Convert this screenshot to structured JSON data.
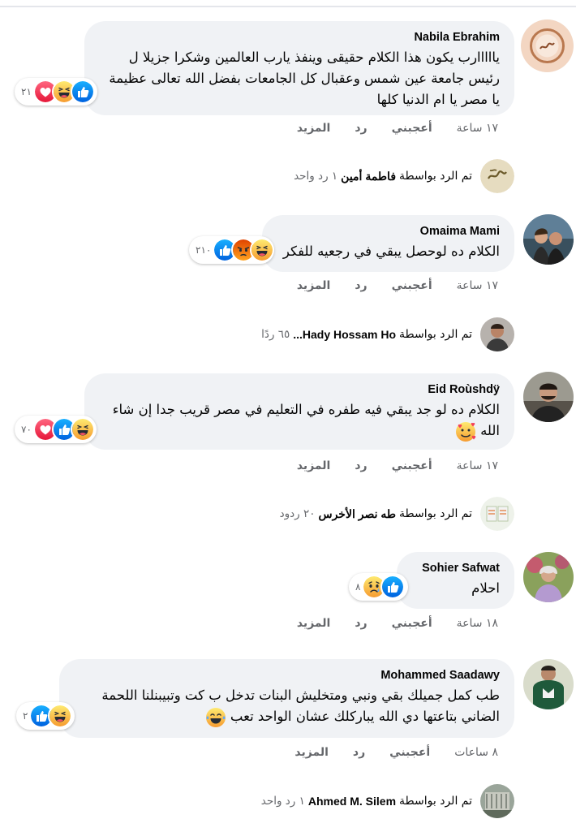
{
  "actions_labels": {
    "more": "المزيد",
    "reply": "رد",
    "like": "أعجبني"
  },
  "reply_prefix": "تم الرد بواسطة",
  "comments": [
    {
      "author": "Nabila Ebrahim",
      "lines": [
        "يااااارب يكون هذا الكلام حقيقى وينفذ يارب العالمين وشكرا جزيلا ل",
        "رئيس جامعة عين شمس وعقبال كل الجامعات بفضل الله تعالى عظيمة",
        "يا مصر يا ام الدنيا كلها"
      ],
      "reactions": {
        "count": "٢١",
        "icons": [
          "like-icon",
          "haha-icon",
          "love-icon"
        ]
      },
      "time": "١٧ ساعة",
      "reply": {
        "name": "فاطمة أمين",
        "count": "١ رد واحد"
      }
    },
    {
      "author": "Omaima Mami",
      "lines": [
        "الكلام ده لوحصل يبقي في رجعيه للفكر"
      ],
      "reactions": {
        "count": "٢١٠",
        "icons": [
          "like-icon",
          "angry-icon",
          "haha-icon"
        ]
      },
      "time": "١٧ ساعة",
      "reply": {
        "name": "Hady Hossam Ho...",
        "count": "٦٥ ردًا"
      }
    },
    {
      "author": "Eid Roùshdÿ",
      "lines": [
        "الكلام ده لو جد يبقي فيه طفره في التعليم في مصر قريب جدا إن شاء",
        "الله"
      ],
      "reactions": {
        "count": "٧٠",
        "icons": [
          "love-icon",
          "like-icon",
          "haha-icon"
        ]
      },
      "time": "١٧ ساعة",
      "reply": {
        "name": "طه نصر الأخرس",
        "count": "٢٠ ردود"
      }
    },
    {
      "author": "Sohier Safwat",
      "lines": [
        "احلام"
      ],
      "reactions": {
        "count": "٨",
        "icons": [
          "sad-icon",
          "like-icon"
        ]
      },
      "time": "١٨ ساعة"
    },
    {
      "author": "Mohammed Saadawy",
      "lines": [
        "طب كمل جميلك بقي ونبي ومتخليش البنات تدخل ب كت وتبيبنلنا اللحمة",
        "الضاني بتاعتها دي الله يباركلك عشان الواحد تعب"
      ],
      "reactions": {
        "count": "٢",
        "icons": [
          "like-icon",
          "haha-icon"
        ]
      },
      "time": "٨ ساعات",
      "reply": {
        "name": "Ahmed M. Silem",
        "count": "١ رد واحد"
      }
    }
  ],
  "colors": {
    "bubble": "#f0f2f5",
    "meta": "#65676b",
    "like": "#1877f2",
    "love": "#f33e58",
    "haha": "#f7b125",
    "angry": "#e9710f"
  }
}
